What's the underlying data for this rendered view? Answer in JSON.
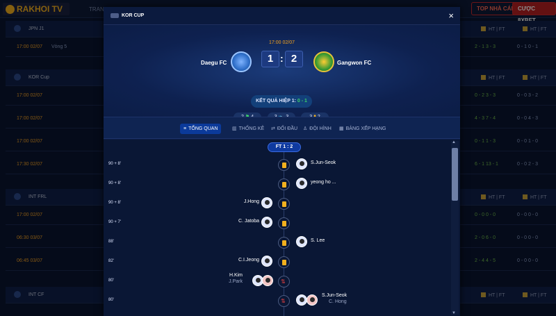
{
  "site": {
    "logo": "RAKHOI TV",
    "nav_item": "TRANG",
    "btn_top": "TOP NHÀ CÁI",
    "btn_bet": "CƯỢC 8XBET"
  },
  "background": {
    "sections": [
      {
        "league": "JPN J1",
        "col1": "HT | FT",
        "col2": "HT | FT",
        "rows": [
          {
            "time": "17:00 02/07",
            "round": "Vòng 5",
            "a": "2 - 1  3 - 3",
            "b": "0 - 1  0 - 1"
          }
        ]
      },
      {
        "league": "KOR Cup",
        "col1": "HT | FT",
        "col2": "HT | FT",
        "rows": [
          {
            "time": "17:00 02/07",
            "a": "0 - 2  3 - 3",
            "b": "0 - 0  3 - 2"
          },
          {
            "time": "17:00 02/07",
            "a": "4 - 3  7 - 4",
            "b": "0 - 0  4 - 3"
          },
          {
            "time": "17:00 02/07",
            "a": "0 - 1  1 - 3",
            "b": "0 - 0  1 - 0"
          },
          {
            "time": "17:30 02/07",
            "a": "6 - 1  13 - 1",
            "b": "0 - 0  2 - 3"
          }
        ]
      },
      {
        "league": "INT FRL",
        "col1": "HT | FT",
        "col2": "HT | FT",
        "rows": [
          {
            "time": "17:00 02/07",
            "a": "0 - 0  0 - 0",
            "b": "0 - 0  0 - 0"
          },
          {
            "time": "06:30 03/07",
            "a": "2 - 0  6 - 0",
            "b": "0 - 0  0 - 0"
          },
          {
            "time": "06:45 03/07",
            "a": "2 - 4  4 - 5",
            "b": "0 - 0  0 - 0"
          }
        ]
      },
      {
        "league": "INT CF",
        "col1": "HT | FT",
        "col2": "HT | FT",
        "rows": []
      }
    ]
  },
  "modal": {
    "title": "KOR CUP",
    "close": "×",
    "datetime": "17:00 02/07",
    "home": {
      "name": "Daegu FC",
      "score": "1"
    },
    "away": {
      "name": "Gangwon FC",
      "score": "2"
    },
    "score_sep": ":",
    "half_time_label": "KẾT QUẢ HIỆP 1:",
    "half_time_score": "0 - 1",
    "stats": [
      {
        "left": "2",
        "icon": "⚑",
        "right": "4"
      },
      {
        "left": "3",
        "icon": "👟",
        "right": "3"
      },
      {
        "left": "3",
        "icon": "▮",
        "right": "2"
      }
    ],
    "tabs": [
      {
        "label": "TỔNG QUAN",
        "icon": "≡"
      },
      {
        "label": "THỐNG KÊ",
        "icon": "▥"
      },
      {
        "label": "ĐỐI ĐẦU",
        "icon": "⇄"
      },
      {
        "label": "ĐỘI HÌNH",
        "icon": "♙"
      },
      {
        "label": "BẢNG XẾP HẠNG",
        "icon": "▦"
      }
    ],
    "ft_label": "FT  1 : 2",
    "events": [
      {
        "minute": "90 + 8'",
        "side": "away",
        "type": "yellow",
        "player": "S.Jun-Seok"
      },
      {
        "minute": "90 + 8'",
        "side": "away",
        "type": "yellow",
        "player": "yeong ho ..."
      },
      {
        "minute": "90 + 8'",
        "side": "home",
        "type": "yellow",
        "player": "J.Hong"
      },
      {
        "minute": "90 + 7'",
        "side": "home",
        "type": "yellow",
        "player": "C. Jatoba"
      },
      {
        "minute": "88'",
        "side": "away",
        "type": "yellow",
        "player": "S. Lee"
      },
      {
        "minute": "82'",
        "side": "home",
        "type": "yellow",
        "player": "C.I.Jeong"
      },
      {
        "minute": "80'",
        "side": "home",
        "type": "sub",
        "player": "H.Kim",
        "player2": "J.Park"
      },
      {
        "minute": "80'",
        "side": "away",
        "type": "sub",
        "player": "S.Jun-Seok",
        "player2": "C. Hong"
      }
    ]
  }
}
